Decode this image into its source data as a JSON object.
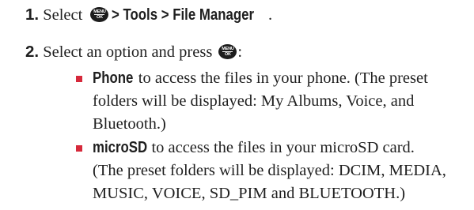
{
  "steps": [
    {
      "number": "1.",
      "text_before": "Select",
      "key_icon": "menu-ok-key",
      "key_top": "MENU",
      "key_bottom": "OK",
      "path": [
        "> Tools",
        "> File Manager"
      ],
      "end": "."
    },
    {
      "number": "2.",
      "text_before": "Select an option and press",
      "key_icon": "menu-ok-key",
      "key_top": "MENU",
      "key_bottom": "OK",
      "end": ":"
    }
  ],
  "options": [
    {
      "term": "Phone",
      "lines": [
        " to access the files in your phone. (The preset",
        "folders will be displayed: My Albums, Voice, and",
        "Bluetooth.)"
      ]
    },
    {
      "term": "microSD",
      "lines": [
        " to access the files in your microSD card.",
        "(The preset folders will be displayed: DCIM, MEDIA,",
        "MUSIC, VOICE, SD_PIM and BLUETOOTH.)"
      ]
    }
  ],
  "colors": {
    "bullet": "#d6293b",
    "text": "#1f1f1f",
    "key": "#1c1c1c"
  }
}
